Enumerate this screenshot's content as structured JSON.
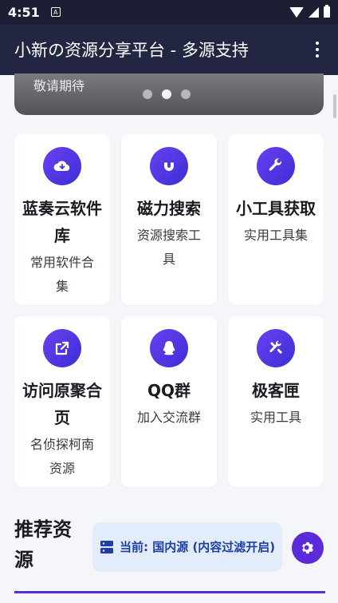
{
  "status_bar": {
    "time": "4:51",
    "notification_glyph": "A"
  },
  "app_bar": {
    "title": "小新の资源分享平台 - 多源支持"
  },
  "banner": {
    "text": "敬请期待",
    "slide_count": 3,
    "active_slide": 2
  },
  "tools": [
    {
      "name": "蓝奏云软件库",
      "desc": "常用软件合集",
      "icon": "cloud-download-icon"
    },
    {
      "name": "磁力搜索",
      "desc": "资源搜索工具",
      "icon": "magnet-icon"
    },
    {
      "name": "小工具获取",
      "desc": "实用工具集",
      "icon": "wrench-icon"
    },
    {
      "name": "访问原聚合页",
      "desc": "名侦探柯南资源",
      "icon": "external-link-icon"
    },
    {
      "name": "QQ群",
      "desc": "加入交流群",
      "icon": "qq-penguin-icon"
    },
    {
      "name": "极客匣",
      "desc": "实用工具",
      "icon": "tools-icon"
    }
  ],
  "recommended": {
    "heading": "推荐资源",
    "source_chip": "当前: 国内源 (内容过滤开启)"
  },
  "colors": {
    "accent": "#5b2bd9",
    "app_bar": "#232642",
    "chip_bg": "#e3ecfa",
    "chip_text": "#1d3fa3"
  }
}
